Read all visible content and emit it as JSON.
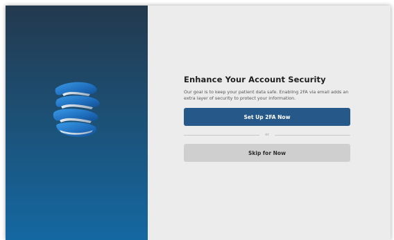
{
  "logo": {
    "icon": "s-ribbon-logo-icon",
    "colors": [
      "#2a8ad8",
      "#1a5fa8",
      "#c9d4df"
    ]
  },
  "prompt": {
    "title": "Enhance Your Account Security",
    "description": "Our goal is to keep your patient data safe. Enabling 2FA via email adds an extra layer of security to protect your information.",
    "primary_button": "Set Up 2FA Now",
    "divider_text": "or",
    "secondary_button": "Skip for Now"
  },
  "colors": {
    "primary": "#26588a",
    "secondary": "#cfcfcf",
    "panel_background": "#ececec",
    "sidebar_gradient": [
      "#23394e",
      "#1468a2"
    ]
  }
}
